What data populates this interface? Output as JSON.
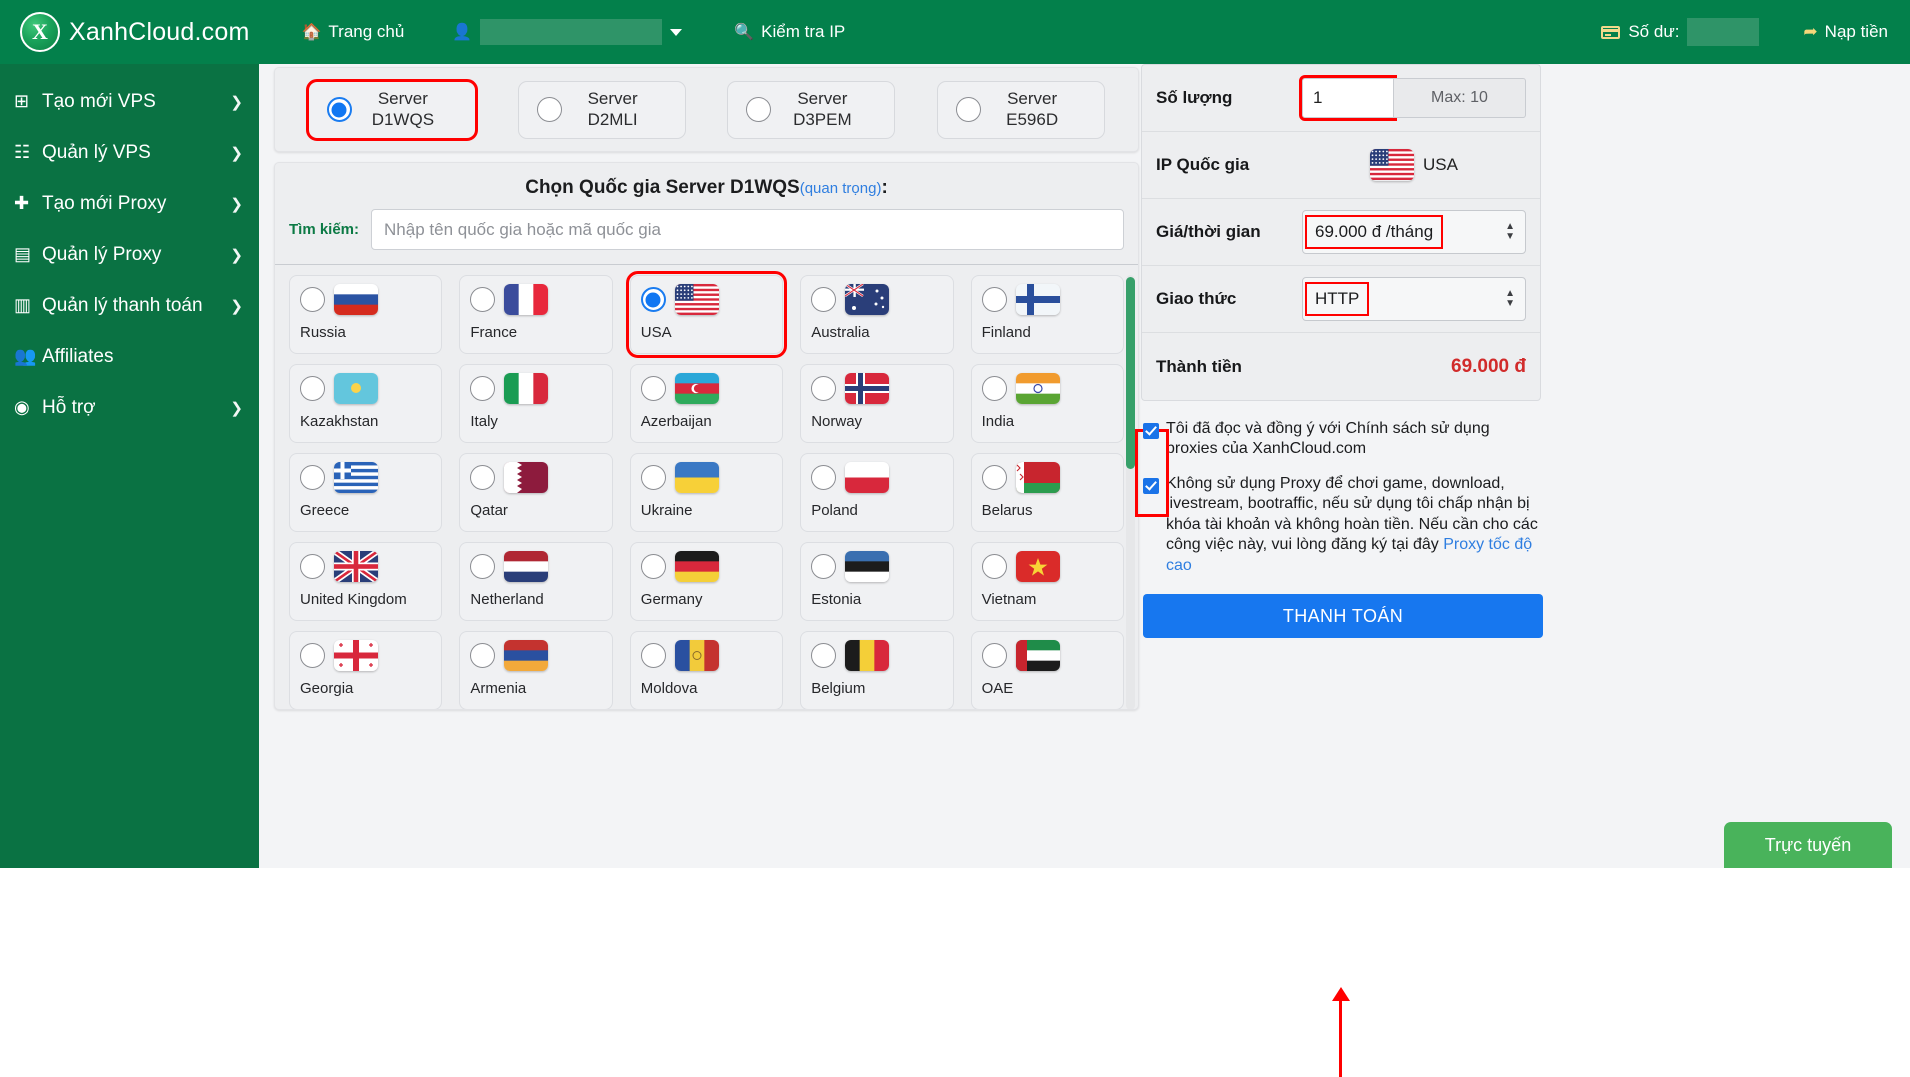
{
  "header": {
    "brand_initial": "X",
    "brand_name": "XanhCloud.com",
    "home_label": "Trang chủ",
    "home_icon": "home-icon",
    "user_icon": "user-icon",
    "user_value": "",
    "check_ip_label": "Kiểm tra IP",
    "check_ip_icon": "search-location-icon",
    "balance_label": "Số dư:",
    "balance_icon": "credit-card-icon",
    "balance_value": "",
    "deposit_label": "Nạp tiền",
    "deposit_icon": "sign-in-icon"
  },
  "sidebar": {
    "items": [
      {
        "label": "Tạo mới VPS",
        "icon": "plus-square-icon",
        "glyph": "⊞",
        "chevron": "❯"
      },
      {
        "label": "Quản lý VPS",
        "icon": "list-icon",
        "glyph": "☰",
        "chevron": "❯"
      },
      {
        "label": "Tạo mới Proxy",
        "icon": "plus-icon",
        "glyph": "✚",
        "chevron": "❯"
      },
      {
        "label": "Quản lý Proxy",
        "icon": "table-icon",
        "glyph": "▤",
        "chevron": "❯"
      },
      {
        "label": "Quản lý thanh toán",
        "icon": "receipt-icon",
        "glyph": "🧾",
        "chevron": "❯"
      },
      {
        "label": "Affiliates",
        "icon": "users-icon",
        "glyph": "👥",
        "chevron": ""
      },
      {
        "label": "Hỗ trợ",
        "icon": "life-ring-icon",
        "glyph": "◉",
        "chevron": "❯"
      }
    ]
  },
  "servers": [
    {
      "line1": "Server",
      "line2": "D1WQS",
      "selected": true,
      "highlighted": true
    },
    {
      "line1": "Server",
      "line2": "D2MLI",
      "selected": false,
      "highlighted": false
    },
    {
      "line1": "Server",
      "line2": "D3PEM",
      "selected": false,
      "highlighted": false
    },
    {
      "line1": "Server",
      "line2": "E596D",
      "selected": false,
      "highlighted": false
    }
  ],
  "country_section": {
    "title": "Chọn Quốc gia Server D1WQS",
    "title_suffix": "(quan trọng)",
    "title_colon": ":",
    "search_label": "Tìm kiếm:",
    "search_placeholder": "Nhập tên quốc gia hoặc mã quốc gia",
    "search_value": "",
    "countries": [
      {
        "name": "Russia",
        "code": "ru",
        "selected": false,
        "highlighted": false
      },
      {
        "name": "France",
        "code": "fr",
        "selected": false,
        "highlighted": false
      },
      {
        "name": "USA",
        "code": "us",
        "selected": true,
        "highlighted": true
      },
      {
        "name": "Australia",
        "code": "au",
        "selected": false,
        "highlighted": false
      },
      {
        "name": "Finland",
        "code": "fi",
        "selected": false,
        "highlighted": false
      },
      {
        "name": "Kazakhstan",
        "code": "kz",
        "selected": false,
        "highlighted": false
      },
      {
        "name": "Italy",
        "code": "it",
        "selected": false,
        "highlighted": false
      },
      {
        "name": "Azerbaijan",
        "code": "az",
        "selected": false,
        "highlighted": false
      },
      {
        "name": "Norway",
        "code": "no",
        "selected": false,
        "highlighted": false
      },
      {
        "name": "India",
        "code": "in",
        "selected": false,
        "highlighted": false
      },
      {
        "name": "Greece",
        "code": "gr",
        "selected": false,
        "highlighted": false
      },
      {
        "name": "Qatar",
        "code": "qa",
        "selected": false,
        "highlighted": false
      },
      {
        "name": "Ukraine",
        "code": "ua",
        "selected": false,
        "highlighted": false
      },
      {
        "name": "Poland",
        "code": "pl",
        "selected": false,
        "highlighted": false
      },
      {
        "name": "Belarus",
        "code": "by",
        "selected": false,
        "highlighted": false
      },
      {
        "name": "United Kingdom",
        "code": "gb",
        "selected": false,
        "highlighted": false
      },
      {
        "name": "Netherland",
        "code": "nl",
        "selected": false,
        "highlighted": false
      },
      {
        "name": "Germany",
        "code": "de",
        "selected": false,
        "highlighted": false
      },
      {
        "name": "Estonia",
        "code": "ee",
        "selected": false,
        "highlighted": false
      },
      {
        "name": "Vietnam",
        "code": "vn",
        "selected": false,
        "highlighted": false
      },
      {
        "name": "Georgia",
        "code": "ge",
        "selected": false,
        "highlighted": false
      },
      {
        "name": "Armenia",
        "code": "am",
        "selected": false,
        "highlighted": false
      },
      {
        "name": "Moldova",
        "code": "md",
        "selected": false,
        "highlighted": false
      },
      {
        "name": "Belgium",
        "code": "be",
        "selected": false,
        "highlighted": false
      },
      {
        "name": "OAE",
        "code": "ae",
        "selected": false,
        "highlighted": false
      }
    ]
  },
  "order": {
    "rows": [
      {
        "label": "Số lượng",
        "kind": "qty"
      },
      {
        "label": "IP Quốc gia",
        "kind": "country"
      },
      {
        "label": "Giá/thời gian",
        "kind": "select_price"
      },
      {
        "label": "Giao thức",
        "kind": "select_proto"
      },
      {
        "label": "Thành tiền",
        "kind": "total"
      }
    ],
    "quantity_value": "1",
    "quantity_max_label": "Max: 10",
    "ip_country": "USA",
    "ip_country_code": "us",
    "price_option": "69.000 đ /tháng",
    "protocol_option": "HTTP",
    "total_amount": "69.000 đ",
    "total_color": "#d12b2b"
  },
  "terms": {
    "items": [
      {
        "checked": true,
        "text": "Tôi đã đọc và đồng ý với Chính sách sử dụng proxies của XanhCloud.com",
        "link_text": "",
        "tail_text": ""
      },
      {
        "checked": true,
        "text": "Không sử dụng Proxy để chơi game, download, livestream, bootraffic, nếu sử dụng tôi chấp nhận bị khóa tài khoản và không hoàn tiền. Nếu cần cho các công việc này, vui lòng đăng ký tại đây ",
        "link_text": "Proxy tốc độ cao",
        "tail_text": ""
      }
    ]
  },
  "payment": {
    "button_label": "THANH TOÁN"
  },
  "online_badge": {
    "label": "Trực tuyến"
  },
  "colors": {
    "brand_green": "#03804b",
    "sidebar_green": "#0a7243",
    "accent_blue": "#1777ef",
    "highlight_red": "#ff0000",
    "total_red": "#d12b2b"
  }
}
